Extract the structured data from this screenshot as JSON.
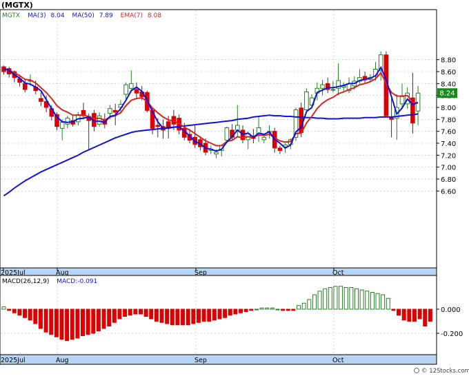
{
  "title": "(MGTX)",
  "indicators": {
    "ticker": "MGTX",
    "ma3": "MA(3)",
    "ma3_value": "8.04",
    "ma50": "MA(50)",
    "ma50_value": "7.89",
    "ema7": "EMA(7)",
    "ema7_value": "8.08"
  },
  "last_price_label": "8.24",
  "macd_label": "MACD(26,12,9)",
  "macd_value_label": "MACD:-0.091",
  "watermark": "© 12Stocks.com",
  "colors": {
    "up": "#208020",
    "down": "#dd0000",
    "ma_blue": "#1010dd",
    "ma_red": "#dd2020",
    "axis_strip": "#b8d4f4",
    "grid": "#c8c8c8",
    "price_box": "#1a8a1a"
  },
  "chart_data": [
    {
      "type": "candlestick",
      "ylim": [
        6.5,
        9.0
      ],
      "y_ticks": [
        6.6,
        6.8,
        7.0,
        7.2,
        7.4,
        7.6,
        7.8,
        8.0,
        8.2,
        8.4,
        8.6,
        8.8
      ],
      "x_labels": [
        "2025Jul",
        "Aug",
        "Sep",
        "Oct"
      ],
      "ohlc": [
        [
          8.68,
          8.7,
          8.55,
          8.6
        ],
        [
          8.65,
          8.68,
          8.5,
          8.56
        ],
        [
          8.6,
          8.62,
          8.42,
          8.5
        ],
        [
          8.48,
          8.55,
          8.35,
          8.42
        ],
        [
          8.4,
          8.48,
          8.25,
          8.3
        ],
        [
          8.44,
          8.55,
          8.36,
          8.45
        ],
        [
          8.34,
          8.45,
          8.22,
          8.28
        ],
        [
          8.15,
          8.25,
          8.02,
          8.1
        ],
        [
          8.1,
          8.2,
          7.92,
          8.0
        ],
        [
          7.98,
          8.04,
          7.78,
          7.85
        ],
        [
          7.88,
          7.92,
          7.62,
          7.68
        ],
        [
          7.65,
          7.8,
          7.45,
          7.75
        ],
        [
          7.72,
          7.86,
          7.65,
          7.82
        ],
        [
          7.78,
          7.88,
          7.68,
          7.72
        ],
        [
          7.76,
          7.92,
          7.7,
          7.88
        ],
        [
          7.95,
          8.08,
          7.8,
          7.86
        ],
        [
          7.85,
          7.9,
          7.3,
          7.78
        ],
        [
          7.9,
          7.96,
          7.6,
          7.68
        ],
        [
          7.72,
          7.92,
          7.68,
          7.86
        ],
        [
          7.8,
          7.9,
          7.65,
          7.72
        ],
        [
          7.9,
          8.04,
          7.8,
          7.98
        ],
        [
          7.95,
          8.06,
          7.7,
          7.92
        ],
        [
          8.0,
          8.12,
          7.92,
          8.05
        ],
        [
          8.22,
          8.42,
          8.12,
          8.38
        ],
        [
          8.32,
          8.62,
          8.26,
          8.4
        ],
        [
          8.3,
          8.42,
          8.16,
          8.24
        ],
        [
          8.26,
          8.36,
          8.12,
          8.18
        ],
        [
          8.25,
          8.28,
          7.92,
          7.95
        ],
        [
          7.95,
          8.0,
          7.55,
          7.65
        ],
        [
          7.7,
          7.82,
          7.5,
          7.68
        ],
        [
          7.68,
          7.8,
          7.48,
          7.62
        ],
        [
          7.76,
          7.86,
          7.48,
          7.66
        ],
        [
          7.85,
          7.96,
          7.62,
          7.72
        ],
        [
          7.82,
          7.88,
          7.55,
          7.62
        ],
        [
          7.65,
          7.74,
          7.45,
          7.5
        ],
        [
          7.55,
          7.64,
          7.4,
          7.45
        ],
        [
          7.5,
          7.7,
          7.32,
          7.38
        ],
        [
          7.46,
          7.52,
          7.28,
          7.34
        ],
        [
          7.4,
          7.48,
          7.2,
          7.25
        ],
        [
          7.28,
          7.36,
          7.22,
          7.3
        ],
        [
          7.22,
          7.3,
          7.15,
          7.25
        ],
        [
          7.28,
          7.38,
          7.18,
          7.36
        ],
        [
          7.45,
          7.68,
          7.4,
          7.66
        ],
        [
          7.62,
          7.72,
          7.46,
          7.5
        ],
        [
          7.62,
          8.04,
          7.5,
          7.7
        ],
        [
          7.62,
          7.7,
          7.4,
          7.46
        ],
        [
          7.46,
          7.6,
          7.3,
          7.56
        ],
        [
          7.52,
          7.64,
          7.4,
          7.48
        ],
        [
          7.54,
          7.85,
          7.42,
          7.66
        ],
        [
          7.46,
          7.56,
          7.4,
          7.5
        ],
        [
          7.58,
          7.7,
          7.48,
          7.6
        ],
        [
          7.6,
          7.66,
          7.24,
          7.32
        ],
        [
          7.32,
          7.36,
          7.22,
          7.28
        ],
        [
          7.34,
          7.4,
          7.24,
          7.37
        ],
        [
          7.38,
          7.48,
          7.3,
          7.46
        ],
        [
          7.5,
          8.0,
          7.44,
          7.96
        ],
        [
          7.99,
          8.08,
          7.5,
          7.58
        ],
        [
          7.96,
          8.32,
          7.9,
          8.26
        ],
        [
          8.04,
          8.22,
          7.98,
          8.16
        ],
        [
          8.24,
          8.42,
          8.12,
          8.32
        ],
        [
          8.32,
          8.46,
          8.2,
          8.38
        ],
        [
          8.4,
          8.5,
          8.24,
          8.3
        ],
        [
          8.3,
          8.44,
          8.25,
          8.3
        ],
        [
          8.32,
          8.74,
          8.2,
          8.45
        ],
        [
          8.34,
          8.42,
          8.26,
          8.36
        ],
        [
          8.28,
          8.5,
          8.24,
          8.4
        ],
        [
          8.36,
          8.52,
          8.3,
          8.44
        ],
        [
          8.44,
          8.64,
          8.4,
          8.5
        ],
        [
          8.52,
          8.6,
          8.4,
          8.46
        ],
        [
          8.47,
          8.56,
          8.42,
          8.5
        ],
        [
          8.52,
          8.76,
          8.45,
          8.64
        ],
        [
          8.62,
          8.94,
          8.45,
          8.88
        ],
        [
          8.88,
          8.94,
          8.1,
          7.86
        ],
        [
          7.84,
          8.15,
          7.5,
          7.8
        ],
        [
          7.82,
          8.22,
          7.46,
          8.0
        ],
        [
          8.06,
          8.4,
          7.98,
          8.18
        ],
        [
          8.06,
          8.34,
          7.98,
          8.24
        ],
        [
          8.16,
          8.58,
          7.56,
          7.74
        ],
        [
          7.94,
          8.36,
          7.7,
          8.24
        ]
      ],
      "ma3": [
        8.65,
        8.62,
        8.55,
        8.49,
        8.41,
        8.39,
        8.34,
        8.28,
        8.13,
        7.98,
        7.84,
        7.76,
        7.75,
        7.76,
        7.81,
        7.82,
        7.84,
        7.77,
        7.77,
        7.75,
        7.85,
        7.87,
        7.98,
        8.12,
        8.28,
        8.34,
        8.27,
        8.12,
        7.93,
        7.76,
        7.65,
        7.65,
        7.67,
        7.67,
        7.61,
        7.52,
        7.43,
        7.39,
        7.32,
        7.3,
        7.27,
        7.3,
        7.42,
        7.51,
        7.62,
        7.55,
        7.57,
        7.5,
        7.57,
        7.55,
        7.59,
        7.47,
        7.4,
        7.32,
        7.37,
        7.59,
        7.67,
        7.93,
        8.0,
        8.25,
        8.29,
        8.33,
        8.33,
        8.35,
        8.37,
        8.4,
        8.4,
        8.45,
        8.47,
        8.49,
        8.53,
        8.67,
        8.46,
        8.18,
        7.89,
        7.99,
        8.14,
        8.05,
        8.08
      ],
      "ema7": [
        8.64,
        8.62,
        8.58,
        8.53,
        8.47,
        8.46,
        8.41,
        8.33,
        8.25,
        8.15,
        8.03,
        7.96,
        7.92,
        7.87,
        7.87,
        7.87,
        7.85,
        7.81,
        7.82,
        7.79,
        7.84,
        7.86,
        7.91,
        8.03,
        8.12,
        8.15,
        8.16,
        8.1,
        7.99,
        7.91,
        7.84,
        7.79,
        7.77,
        7.73,
        7.67,
        7.62,
        7.56,
        7.5,
        7.44,
        7.4,
        7.36,
        7.36,
        7.43,
        7.45,
        7.51,
        7.49,
        7.51,
        7.5,
        7.54,
        7.53,
        7.55,
        7.49,
        7.44,
        7.42,
        7.43,
        7.56,
        7.57,
        7.74,
        7.85,
        7.98,
        8.07,
        8.13,
        8.17,
        8.23,
        8.26,
        8.3,
        8.33,
        8.38,
        8.4,
        8.43,
        8.48,
        8.58,
        8.4,
        8.25,
        8.19,
        8.19,
        8.2,
        8.08,
        8.08
      ],
      "ma50": [
        6.52,
        6.58,
        6.65,
        6.71,
        6.77,
        6.82,
        6.87,
        6.92,
        6.96,
        7.0,
        7.04,
        7.08,
        7.12,
        7.16,
        7.2,
        7.25,
        7.29,
        7.33,
        7.37,
        7.41,
        7.45,
        7.49,
        7.52,
        7.55,
        7.58,
        7.6,
        7.61,
        7.62,
        7.63,
        7.64,
        7.65,
        7.66,
        7.67,
        7.68,
        7.69,
        7.7,
        7.71,
        7.72,
        7.73,
        7.74,
        7.75,
        7.76,
        7.77,
        7.78,
        7.8,
        7.81,
        7.82,
        7.84,
        7.85,
        7.86,
        7.87,
        7.86,
        7.86,
        7.85,
        7.85,
        7.84,
        7.84,
        7.83,
        7.83,
        7.82,
        7.82,
        7.81,
        7.81,
        7.81,
        7.82,
        7.82,
        7.82,
        7.82,
        7.83,
        7.83,
        7.83,
        7.84,
        7.84,
        7.84,
        7.85,
        7.86,
        7.87,
        7.88,
        7.89
      ]
    },
    {
      "type": "bar",
      "series_name": "MACD",
      "ylim": [
        -0.3,
        0.22
      ],
      "y_ticks": [
        0.0,
        -0.2
      ],
      "y_tick_labels": [
        "0.000",
        "-0.200"
      ],
      "x_labels": [
        "2025Jul",
        "Aug",
        "Sep",
        "Oct"
      ],
      "values": [
        0.02,
        -0.01,
        -0.03,
        -0.05,
        -0.07,
        -0.09,
        -0.12,
        -0.16,
        -0.19,
        -0.21,
        -0.23,
        -0.25,
        -0.26,
        -0.25,
        -0.24,
        -0.22,
        -0.21,
        -0.2,
        -0.18,
        -0.16,
        -0.14,
        -0.11,
        -0.08,
        -0.06,
        -0.05,
        -0.04,
        -0.04,
        -0.06,
        -0.08,
        -0.1,
        -0.11,
        -0.12,
        -0.13,
        -0.13,
        -0.13,
        -0.13,
        -0.12,
        -0.11,
        -0.1,
        -0.1,
        -0.09,
        -0.08,
        -0.07,
        -0.05,
        -0.04,
        -0.03,
        -0.02,
        -0.01,
        0.0,
        0.01,
        0.01,
        0.01,
        0.0,
        -0.01,
        -0.01,
        -0.01,
        0.03,
        0.05,
        0.08,
        0.12,
        0.15,
        0.17,
        0.18,
        0.19,
        0.19,
        0.18,
        0.18,
        0.17,
        0.16,
        0.15,
        0.14,
        0.13,
        0.12,
        0.09,
        -0.01,
        -0.05,
        -0.09,
        -0.1,
        -0.1,
        -0.08,
        -0.14,
        -0.1
      ]
    }
  ]
}
